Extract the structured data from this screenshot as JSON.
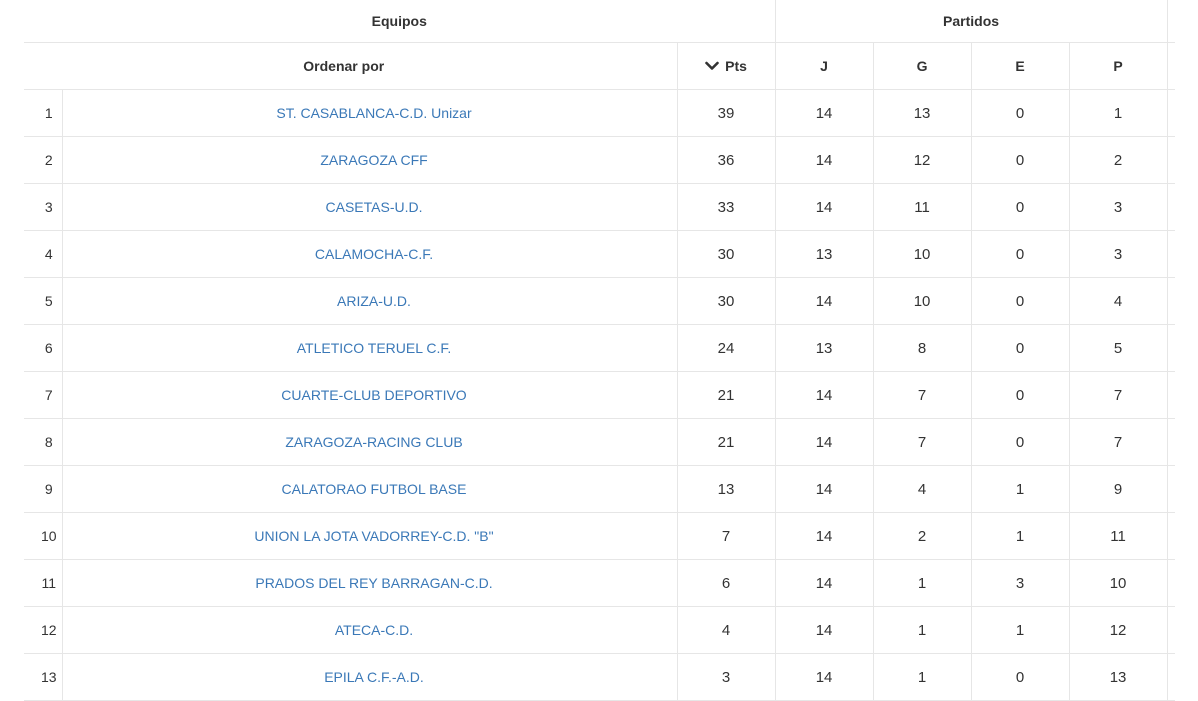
{
  "header": {
    "equipos": "Equipos",
    "partidos": "Partidos",
    "ordenar_por": "Ordenar por",
    "pts": "Pts",
    "j": "J",
    "g": "G",
    "e": "E",
    "p": "P"
  },
  "rows": [
    {
      "pos": "1",
      "team": "ST. CASABLANCA-C.D. Unizar",
      "pts": "39",
      "j": "14",
      "g": "13",
      "e": "0",
      "p": "1"
    },
    {
      "pos": "2",
      "team": "ZARAGOZA CFF",
      "pts": "36",
      "j": "14",
      "g": "12",
      "e": "0",
      "p": "2"
    },
    {
      "pos": "3",
      "team": "CASETAS-U.D.",
      "pts": "33",
      "j": "14",
      "g": "11",
      "e": "0",
      "p": "3"
    },
    {
      "pos": "4",
      "team": "CALAMOCHA-C.F.",
      "pts": "30",
      "j": "13",
      "g": "10",
      "e": "0",
      "p": "3"
    },
    {
      "pos": "5",
      "team": "ARIZA-U.D.",
      "pts": "30",
      "j": "14",
      "g": "10",
      "e": "0",
      "p": "4"
    },
    {
      "pos": "6",
      "team": "ATLETICO TERUEL C.F.",
      "pts": "24",
      "j": "13",
      "g": "8",
      "e": "0",
      "p": "5"
    },
    {
      "pos": "7",
      "team": "CUARTE-CLUB DEPORTIVO",
      "pts": "21",
      "j": "14",
      "g": "7",
      "e": "0",
      "p": "7"
    },
    {
      "pos": "8",
      "team": "ZARAGOZA-RACING CLUB",
      "pts": "21",
      "j": "14",
      "g": "7",
      "e": "0",
      "p": "7"
    },
    {
      "pos": "9",
      "team": "CALATORAO FUTBOL BASE",
      "pts": "13",
      "j": "14",
      "g": "4",
      "e": "1",
      "p": "9"
    },
    {
      "pos": "10",
      "team": "UNION LA JOTA VADORREY-C.D. \"B\"",
      "pts": "7",
      "j": "14",
      "g": "2",
      "e": "1",
      "p": "11"
    },
    {
      "pos": "11",
      "team": "PRADOS DEL REY BARRAGAN-C.D.",
      "pts": "6",
      "j": "14",
      "g": "1",
      "e": "3",
      "p": "10"
    },
    {
      "pos": "12",
      "team": "ATECA-C.D.",
      "pts": "4",
      "j": "14",
      "g": "1",
      "e": "1",
      "p": "12"
    },
    {
      "pos": "13",
      "team": "EPILA C.F.-A.D.",
      "pts": "3",
      "j": "14",
      "g": "1",
      "e": "0",
      "p": "13"
    }
  ],
  "colors": {
    "link": "#3a78b7",
    "border": "#e6e6e6",
    "text": "#333333"
  },
  "icons": {
    "sort": "chevron-down-icon"
  }
}
